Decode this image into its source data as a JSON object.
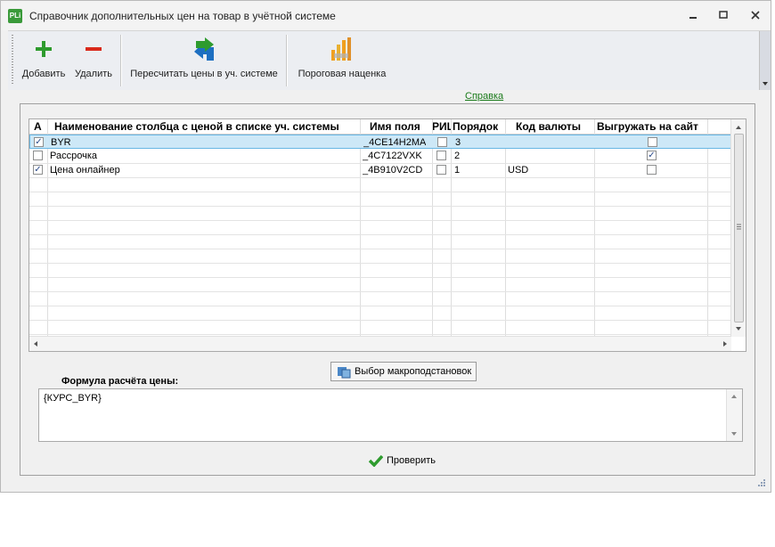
{
  "window": {
    "title": "Справочник дополнительных цен на товар в учётной системе",
    "icon_text": "PLi"
  },
  "toolbar": {
    "add_label": "Добавить",
    "delete_label": "Удалить",
    "recalc_label": "Пересчитать цены в уч. системе",
    "threshold_label": "Пороговая наценка"
  },
  "help_link": "Справка",
  "grid": {
    "headers": [
      "А",
      "Наименование столбца с ценой в списке уч. системы",
      "Имя поля",
      "РИЦ",
      "Порядок",
      "Код валюты",
      "Выгружать на сайт"
    ],
    "rows": [
      {
        "active": true,
        "name": "BYR",
        "field": "_4CE14H2MA",
        "ric": false,
        "order": "3",
        "currency": "",
        "export": false
      },
      {
        "active": false,
        "name": "Рассрочка",
        "field": "_4C7122VXK",
        "ric": false,
        "order": "2",
        "currency": "",
        "export": true
      },
      {
        "active": true,
        "name": "Цена онлайнер",
        "field": "_4B910V2CD",
        "ric": false,
        "order": "1",
        "currency": "USD",
        "export": false
      }
    ]
  },
  "macro_button": "Выбор макроподстановок",
  "formula": {
    "label": "Формула расчёта цены:",
    "value": "{КУРС_BYR}"
  },
  "check_button": "Проверить",
  "colors": {
    "accent_green": "#2e9b2e",
    "selection": "#cde8f7",
    "delete_red": "#d92a1c"
  }
}
